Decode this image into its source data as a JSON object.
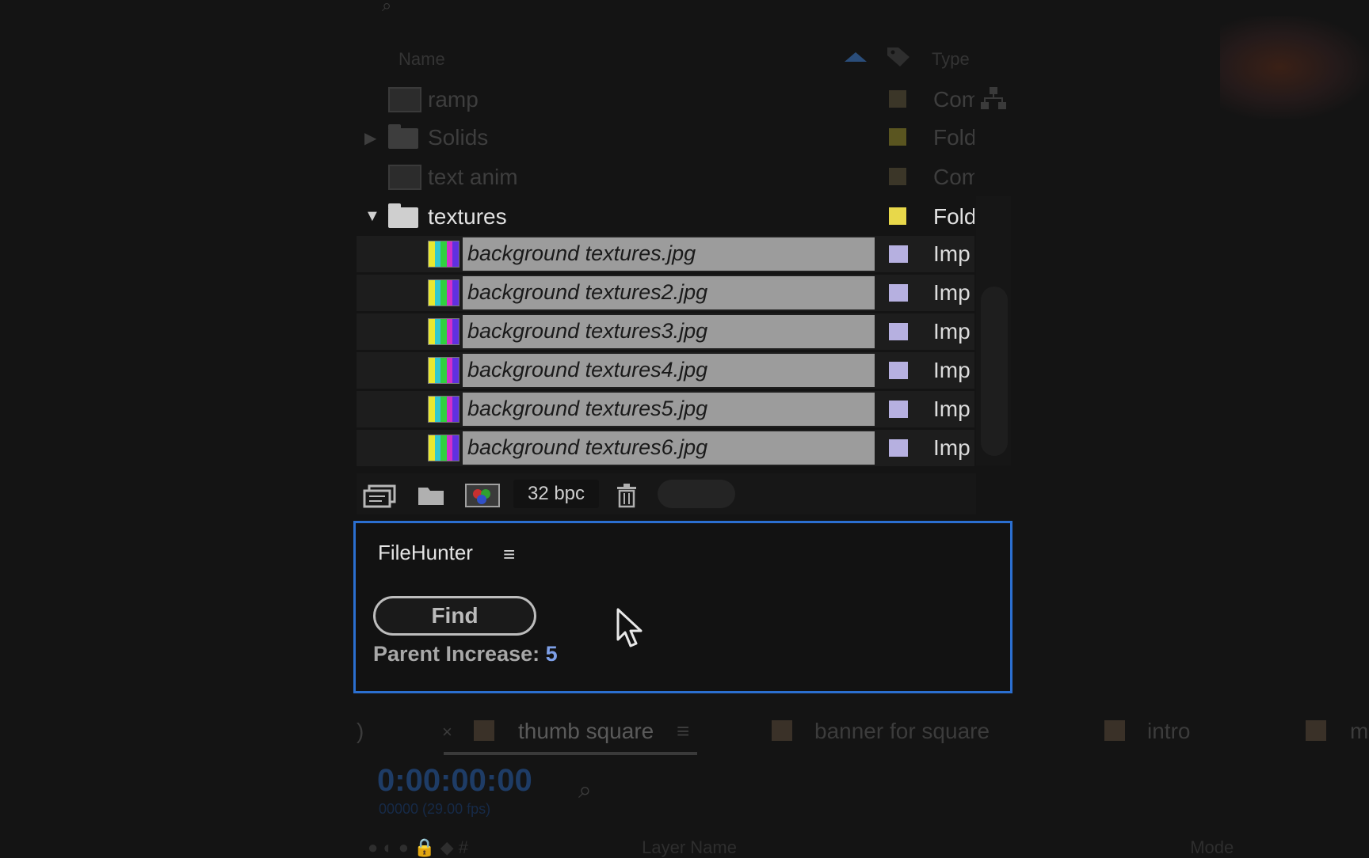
{
  "project_panel": {
    "column_name": "Name",
    "column_type": "Type",
    "items": [
      {
        "label": "ramp",
        "type": "Com",
        "kind": "comp",
        "swatch": "#3b3628"
      },
      {
        "label": "Solids",
        "type": "Fold",
        "kind": "folder",
        "swatch": "#5a5520"
      },
      {
        "label": "text anim",
        "type": "Com",
        "kind": "comp",
        "swatch": "#3b3628"
      },
      {
        "label": "textures",
        "type": "Fold",
        "kind": "folder",
        "swatch": "#e8d84a"
      }
    ],
    "files": [
      {
        "name": "background textures.jpg",
        "type": "Imp"
      },
      {
        "name": "background textures2.jpg",
        "type": "Imp"
      },
      {
        "name": "background textures3.jpg",
        "type": "Imp"
      },
      {
        "name": "background textures4.jpg",
        "type": "Imp"
      },
      {
        "name": "background textures5.jpg",
        "type": "Imp"
      },
      {
        "name": "background textures6.jpg",
        "type": "Imp"
      }
    ],
    "bpc": "32 bpc"
  },
  "filehunter": {
    "title": "FileHunter",
    "menu_glyph": "≡",
    "find_label": "Find",
    "parent_label": "Parent Increase:",
    "parent_value": "5"
  },
  "timeline": {
    "tabs": [
      {
        "label": "thumb square",
        "active": true
      },
      {
        "label": "banner for square",
        "active": false
      },
      {
        "label": "intro",
        "active": false
      },
      {
        "label": "m",
        "active": false
      }
    ],
    "timecode": "0:00:00:00",
    "fps": "00000 (29.00 fps)",
    "columns": "Layer Name",
    "mode_col": "Mode"
  },
  "colors": {
    "accent": "#2b6fd0",
    "selection": "#9c9c9c",
    "import_swatch": "#b6b0e0",
    "folder_swatch": "#e8d84a"
  }
}
